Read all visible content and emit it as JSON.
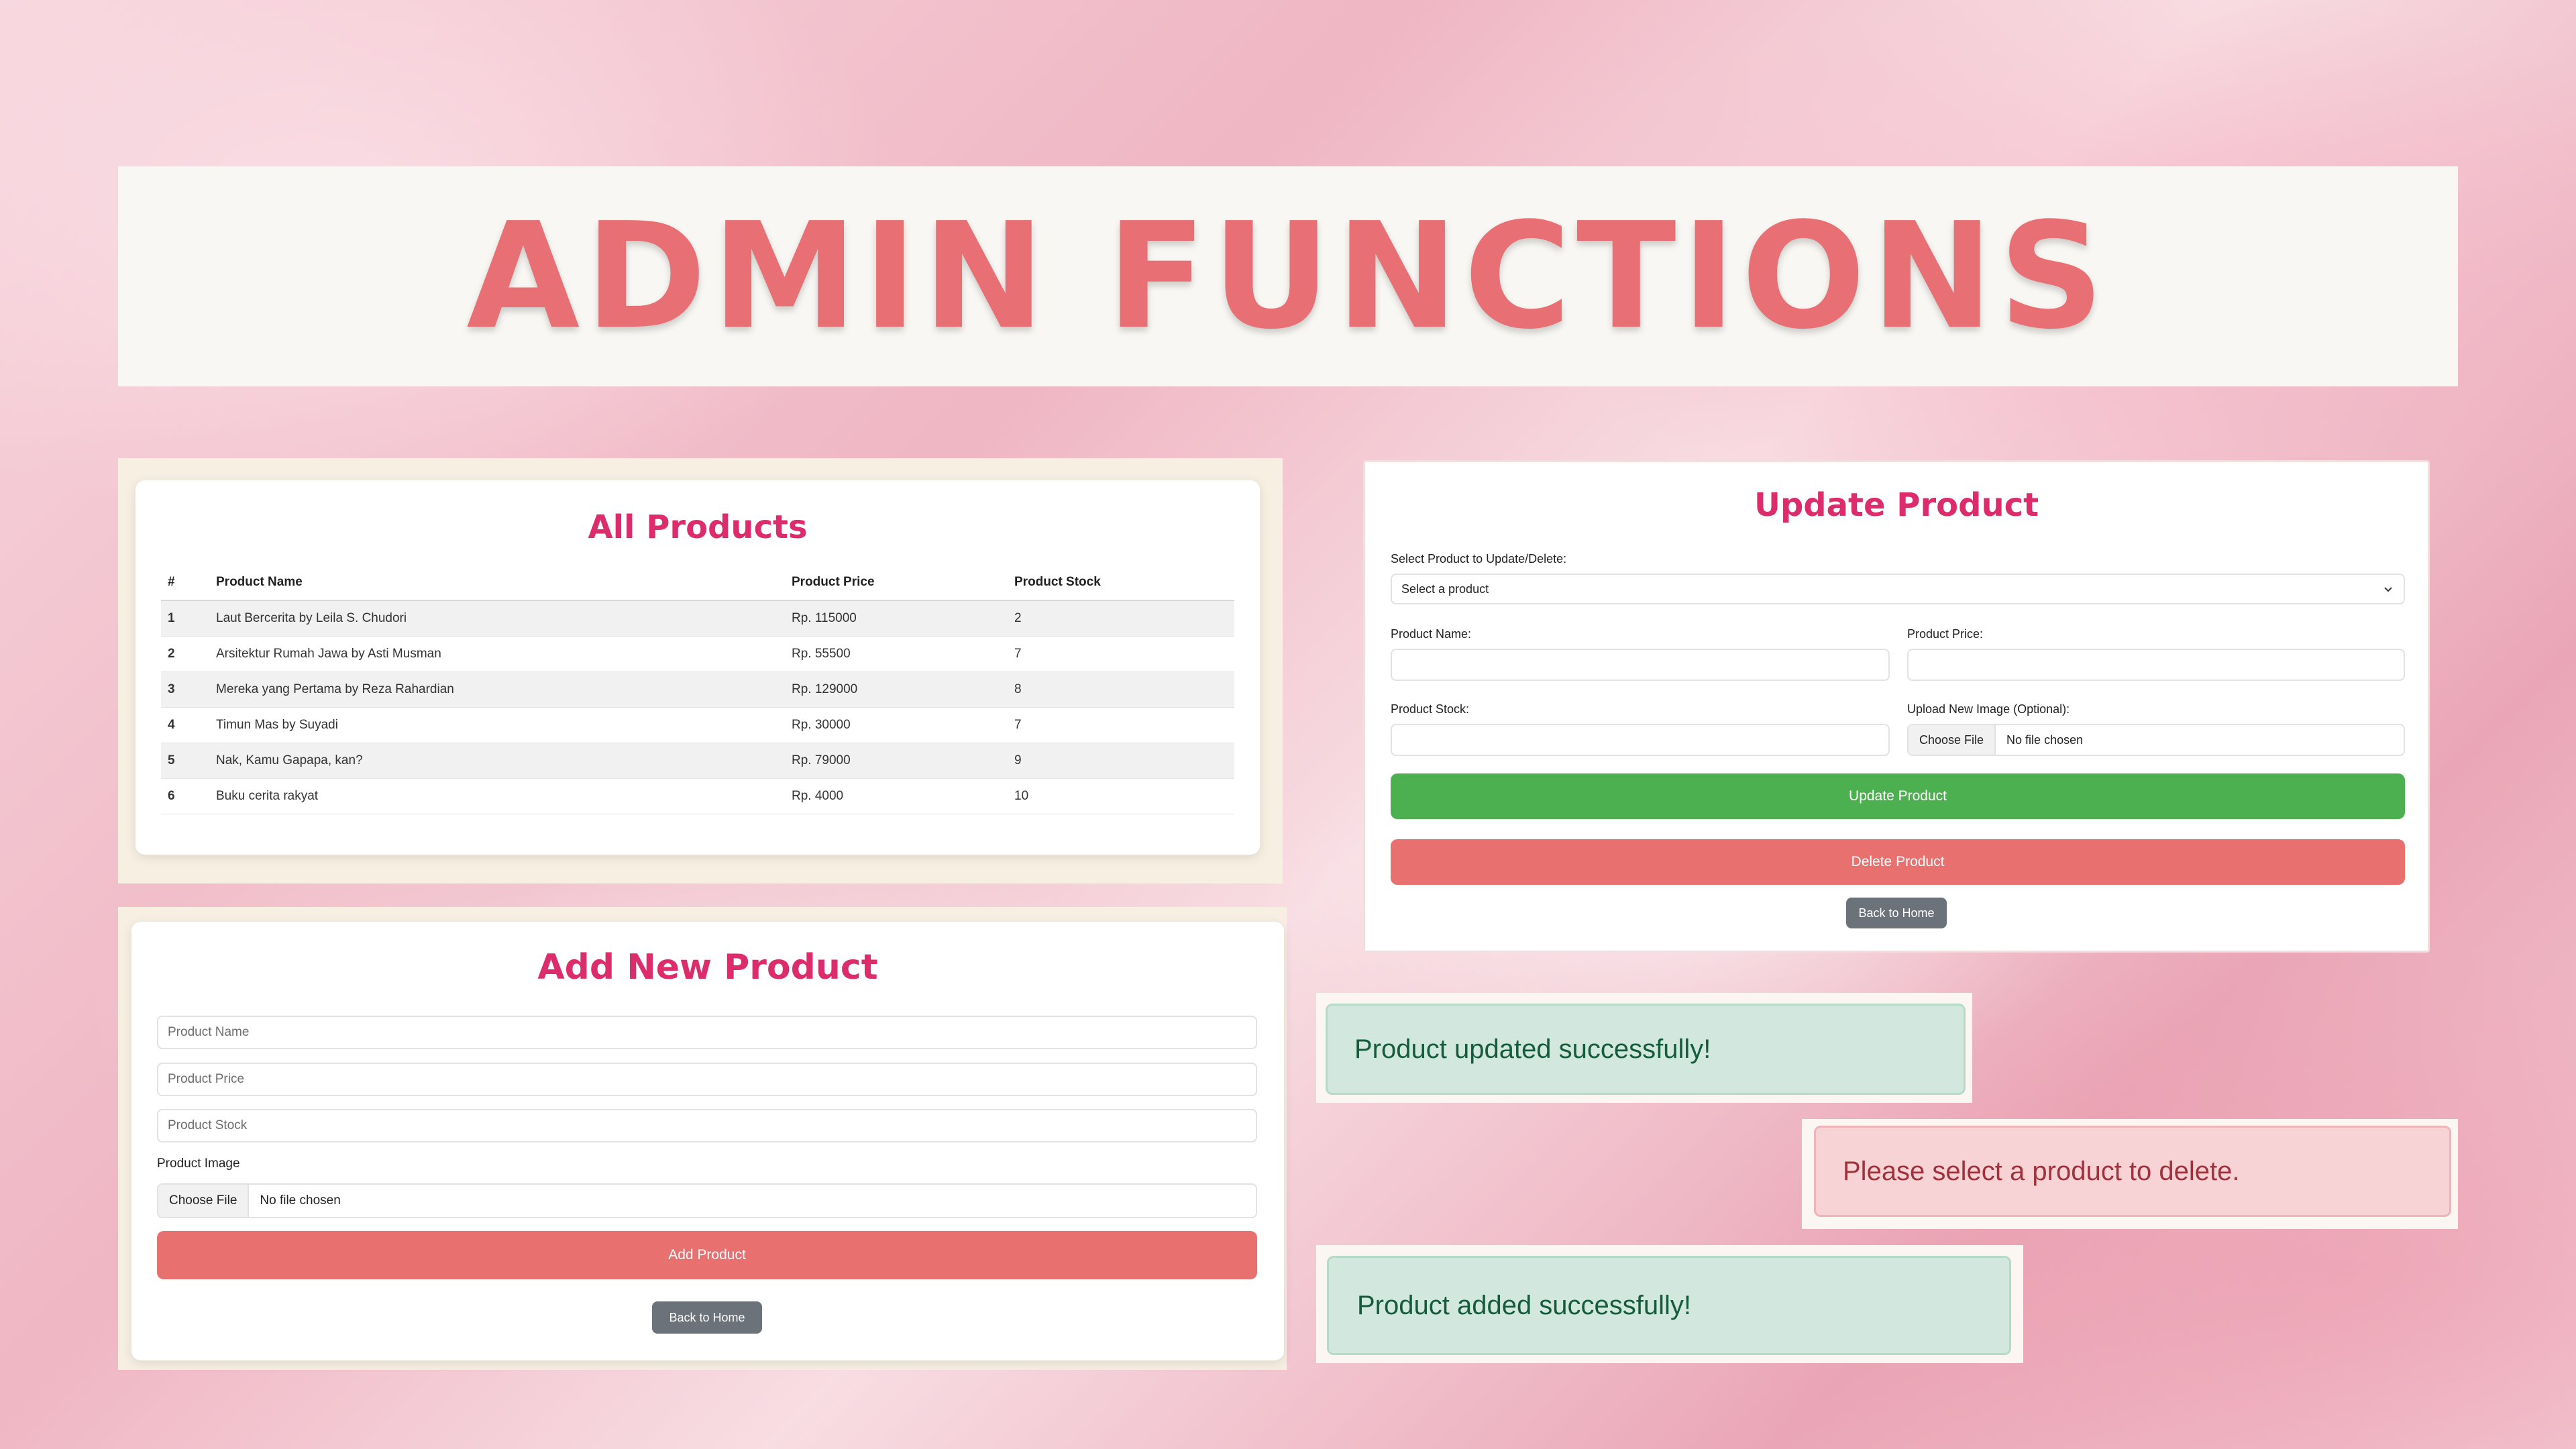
{
  "banner": {
    "title": "ADMIN FUNCTIONS"
  },
  "all_products": {
    "title": "All Products",
    "columns": [
      "#",
      "Product Name",
      "Product Price",
      "Product Stock"
    ],
    "rows": [
      {
        "num": "1",
        "name": "Laut Bercerita by Leila S. Chudori",
        "price": "Rp. 115000",
        "stock": "2"
      },
      {
        "num": "2",
        "name": "Arsitektur Rumah Jawa by Asti Musman",
        "price": "Rp. 55500",
        "stock": "7"
      },
      {
        "num": "3",
        "name": "Mereka yang Pertama by Reza Rahardian",
        "price": "Rp. 129000",
        "stock": "8"
      },
      {
        "num": "4",
        "name": "Timun Mas by Suyadi",
        "price": "Rp. 30000",
        "stock": "7"
      },
      {
        "num": "5",
        "name": "Nak, Kamu Gapapa, kan?",
        "price": "Rp. 79000",
        "stock": "9"
      },
      {
        "num": "6",
        "name": "Buku cerita rakyat",
        "price": "Rp. 4000",
        "stock": "10"
      }
    ]
  },
  "add_product": {
    "title": "Add New Product",
    "name_placeholder": "Product Name",
    "price_placeholder": "Product Price",
    "stock_placeholder": "Product Stock",
    "image_label": "Product Image",
    "choose_file": "Choose File",
    "no_file": "No file chosen",
    "submit": "Add Product",
    "back": "Back to Home"
  },
  "update_product": {
    "title": "Update Product",
    "select_label": "Select Product to Update/Delete:",
    "select_value": "Select a product",
    "name_label": "Product Name:",
    "price_label": "Product Price:",
    "stock_label": "Product Stock:",
    "image_label": "Upload New Image (Optional):",
    "choose_file": "Choose File",
    "no_file": "No file chosen",
    "update_button": "Update Product",
    "delete_button": "Delete Product",
    "back": "Back to Home"
  },
  "alerts": {
    "updated": "Product updated successfully!",
    "select_delete": "Please select a product to delete.",
    "added": "Product added successfully!"
  },
  "colors": {
    "title_accent": "#e86f74",
    "card_title": "#dd2c6b",
    "red_button": "#e87170",
    "green_button": "#4caf50",
    "gray_button": "#6b727a",
    "success_bg": "#d2e7dd",
    "danger_bg": "#f8d3d6"
  },
  "icons": {
    "select_arrow": "chevron-down-icon"
  }
}
